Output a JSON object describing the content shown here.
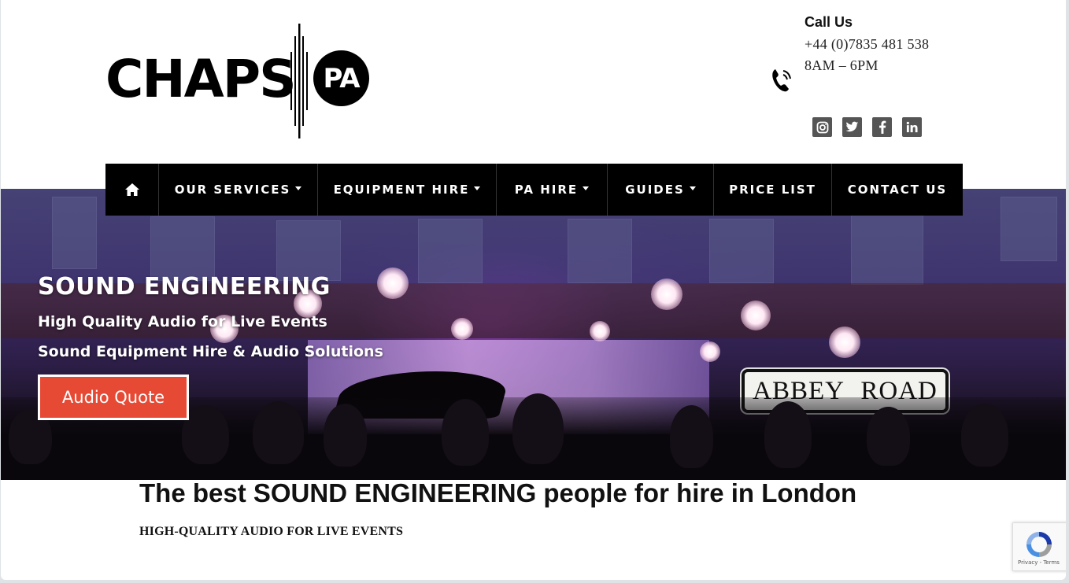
{
  "brand": {
    "name": "CHAPS",
    "badge": "PA"
  },
  "contact": {
    "title": "Call Us",
    "phone": "+44 (0)7835 481 538",
    "hours": "8AM – 6PM"
  },
  "social": [
    {
      "icon": "instagram-icon",
      "glyph": "◙"
    },
    {
      "icon": "twitter-icon",
      "glyph": "t"
    },
    {
      "icon": "facebook-icon",
      "glyph": "f"
    },
    {
      "icon": "linkedin-icon",
      "glyph": "in"
    }
  ],
  "nav": {
    "home_icon": "home-icon",
    "items": [
      {
        "label": "OUR SERVICES",
        "dropdown": true
      },
      {
        "label": "EQUIPMENT HIRE",
        "dropdown": true
      },
      {
        "label": "PA HIRE",
        "dropdown": true
      },
      {
        "label": "GUIDES",
        "dropdown": true
      },
      {
        "label": "PRICE LIST",
        "dropdown": false
      },
      {
        "label": "CONTACT US",
        "dropdown": false
      }
    ]
  },
  "hero": {
    "title": "SOUND ENGINEERING",
    "subtitle_1": "High Quality Audio for Live Events",
    "subtitle_2": "Sound Equipment Hire & Audio Solutions",
    "cta": "Audio Quote",
    "sign_word_1": "ABBEY",
    "sign_word_2": "ROAD"
  },
  "content": {
    "headline": "The best SOUND ENGINEERING people for hire in London",
    "subheading": "HIGH-QUALITY AUDIO FOR LIVE EVENTS"
  },
  "recaptcha": {
    "links": "Privacy - Terms"
  },
  "colors": {
    "accent": "#e64a35",
    "nav_bg": "#000000",
    "social_bg": "#555555"
  }
}
